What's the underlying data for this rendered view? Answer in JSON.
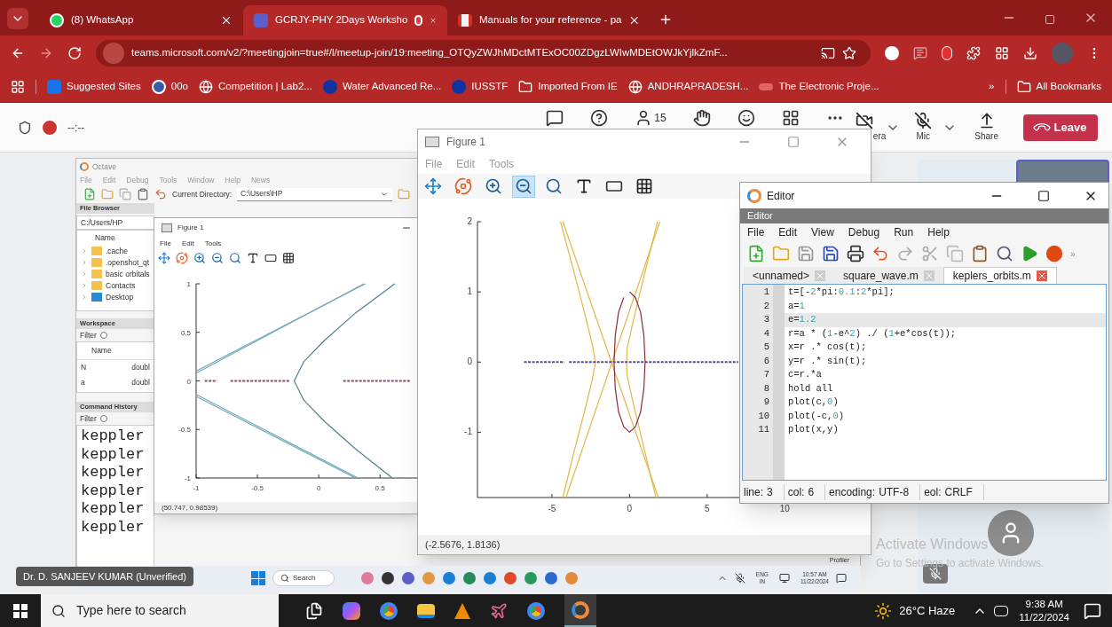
{
  "browser": {
    "tabs": [
      {
        "label": "(8) WhatsApp",
        "kind": "whatsapp",
        "selected": false
      },
      {
        "label": "GCRJY-PHY 2Days Worksho",
        "kind": "teams",
        "selected": true
      },
      {
        "label": "Manuals for your reference - pa",
        "kind": "gmail",
        "selected": false
      }
    ],
    "url": "teams.microsoft.com/v2/?meetingjoin=true#/l/meetup-join/19:meeting_OTQyZWJhMDctMTExOC00ZDgzLWIwMDEtOWJkYjlkZmF...",
    "bookmarks": [
      {
        "label": "Suggested Sites",
        "kind": "bing"
      },
      {
        "label": "00o",
        "kind": "site"
      },
      {
        "label": "Competition | Lab2...",
        "kind": "globe"
      },
      {
        "label": "Water Advanced Re...",
        "kind": "jio"
      },
      {
        "label": "IUSSTF",
        "kind": "jio"
      },
      {
        "label": "Imported From IE",
        "kind": "folder"
      },
      {
        "label": "ANDHRAPRADESH...",
        "kind": "globe"
      },
      {
        "label": "The Electronic Proje...",
        "kind": "link"
      }
    ],
    "more": "»",
    "all_bookmarks": "All Bookmarks"
  },
  "meeting": {
    "timer": "--:--",
    "participants": "15",
    "camera_label": "era",
    "mic_label": "Mic",
    "share_label": "Share",
    "leave_label": "Leave"
  },
  "octave": {
    "title": "Octave",
    "menu": [
      "File",
      "Edit",
      "Debug",
      "Tools",
      "Window",
      "Help",
      "News"
    ],
    "dir_label": "Current Directory:",
    "dir_value": "C:\\Users\\HP",
    "file_browser": {
      "title": "File Browser",
      "path": "C:/Users/HP",
      "column": "Name",
      "items": [
        {
          "name": ".cache",
          "kind": "folder"
        },
        {
          "name": ".openshot_qt",
          "kind": "folder"
        },
        {
          "name": "basic orbitals",
          "kind": "folder"
        },
        {
          "name": "Contacts",
          "kind": "folder"
        },
        {
          "name": "Desktop",
          "kind": "desktop"
        }
      ]
    },
    "workspace": {
      "title": "Workspace",
      "filter": "Filter",
      "filter_checked": false,
      "column": "Name",
      "rows": [
        {
          "name": "N",
          "class": "doubl"
        },
        {
          "name": "a",
          "class": "doubl"
        }
      ]
    },
    "history": {
      "title": "Command History",
      "filter": "Filter",
      "filter_checked": false,
      "items": [
        "keppler",
        "keppler",
        "keppler",
        "keppler",
        "keppler",
        "keppler"
      ]
    },
    "profiler": "Profiler"
  },
  "small_figure": {
    "title": "Figure 1",
    "menu": [
      "File",
      "Edit",
      "Tools"
    ],
    "status": "(50.747, 0.98539)",
    "chart_data": {
      "type": "line",
      "xlim": [
        -1,
        0.81
      ],
      "ylim": [
        -1,
        1
      ],
      "xticks": [
        -1,
        -0.5,
        0,
        0.5
      ],
      "yticks": [
        -1,
        -0.5,
        0,
        0.5,
        1
      ],
      "series": [
        {
          "color": "#6fa8b8",
          "x": [
            -1,
            0.37
          ],
          "values": [
            0.08,
            1
          ]
        },
        {
          "color": "#6fa8b8",
          "x": [
            -1,
            0.38
          ],
          "values": [
            0.1,
            1
          ]
        },
        {
          "color": "#6fa8b8",
          "x": [
            -1,
            0.32
          ],
          "values": [
            -0.14,
            -1
          ]
        },
        {
          "color": "#6fa8b8",
          "x": [
            -1,
            0.3
          ],
          "values": [
            -0.16,
            -1
          ]
        },
        {
          "color": "#4f7f90",
          "x": [
            0.62,
            0.3,
            0.05,
            -0.12,
            -0.2,
            -0.12,
            0.05,
            0.3,
            0.6
          ],
          "values": [
            1,
            0.7,
            0.42,
            0.2,
            0,
            -0.2,
            -0.42,
            -0.7,
            -1
          ]
        },
        {
          "color": "#8a4a6a",
          "line_style": "dotted",
          "x": [
            -0.93,
            -0.83,
            null,
            -0.72,
            -0.24,
            null,
            0.2,
            0.75
          ],
          "values": [
            0,
            0,
            null,
            0,
            0,
            null,
            0,
            0
          ]
        }
      ]
    }
  },
  "figure": {
    "title": "Figure 1",
    "menu": [
      "File",
      "Edit",
      "Tools"
    ],
    "status": "(-2.5676, 1.8136)",
    "toolbar": [
      {
        "kind": "pan",
        "selected": false
      },
      {
        "kind": "rotate",
        "selected": false
      },
      {
        "kind": "zoom-in",
        "selected": false
      },
      {
        "kind": "zoom-out",
        "selected": true
      },
      {
        "kind": "reset",
        "selected": false
      },
      {
        "kind": "text",
        "selected": false
      },
      {
        "kind": "axes",
        "selected": false
      },
      {
        "kind": "grid",
        "selected": false
      }
    ],
    "chart_data": {
      "type": "line",
      "xlim": [
        -9.8,
        14.5
      ],
      "ylim": [
        -1.93,
        2
      ],
      "xticks": [
        -5,
        0,
        5,
        10
      ],
      "yticks": [
        -1,
        0,
        1,
        2
      ],
      "series": [
        {
          "color": "#e3b547",
          "x": [
            -4.45,
            -3.6,
            -2.9,
            -2.4,
            -2.2,
            -2.4,
            -2.9,
            -3.6,
            -4.3
          ],
          "values": [
            2,
            1.3,
            0.7,
            0.25,
            0,
            -0.25,
            -0.7,
            -1.3,
            -1.93
          ]
        },
        {
          "color": "#e3b547",
          "x": [
            -4.3,
            1.85
          ],
          "values": [
            2,
            -1.93
          ]
        },
        {
          "color": "#e3b547",
          "x": [
            -4.1,
            1.95
          ],
          "values": [
            -1.93,
            2
          ]
        },
        {
          "color": "#e3b547",
          "x": [
            1.8,
            0.9,
            0.2,
            -0.15,
            -0.2,
            -0.15,
            0.2,
            0.9,
            1.7
          ],
          "values": [
            2,
            1.2,
            0.55,
            0.2,
            0,
            -0.2,
            -0.55,
            -1.2,
            -1.93
          ]
        },
        {
          "color": "#8b3030",
          "x": [
            0,
            0.38,
            0.71,
            0.92,
            1,
            0.92,
            0.71,
            0.38,
            0,
            -0.38,
            -0.71,
            -0.92,
            -1,
            -0.92,
            -0.71,
            -0.38
          ],
          "values": [
            1,
            0.92,
            0.71,
            0.38,
            0,
            -0.38,
            -0.71,
            -0.92,
            -1,
            -0.92,
            -0.71,
            -0.38,
            0,
            0.38,
            0.71,
            0.92
          ]
        },
        {
          "color": "#5a4a8a",
          "line_style": "dotted",
          "x": [
            -6.8,
            -4.2,
            null,
            -3.9,
            7
          ],
          "values": [
            0,
            0,
            null,
            0,
            0
          ]
        }
      ]
    }
  },
  "editor": {
    "title": "Editor",
    "dock_title": "Editor",
    "menu": [
      "File",
      "Edit",
      "View",
      "Debug",
      "Run",
      "Help"
    ],
    "more": "»",
    "tabs": [
      {
        "label": "<unnamed>",
        "selected": false
      },
      {
        "label": "square_wave.m",
        "selected": false
      },
      {
        "label": "keplers_orbits.m",
        "selected": true
      }
    ],
    "lines": [
      {
        "num": "1",
        "code": "t=[-2*pi:0.1:2*pi];",
        "current": false
      },
      {
        "num": "2",
        "code": "a=1",
        "current": false
      },
      {
        "num": "3",
        "code": "e=1.2",
        "current": true
      },
      {
        "num": "4",
        "code": "r=a * (1-e^2) ./ (1+e*cos(t));",
        "current": false
      },
      {
        "num": "5",
        "code": "x=r .* cos(t);",
        "current": false
      },
      {
        "num": "6",
        "code": "y=r .* sin(t);",
        "current": false
      },
      {
        "num": "7",
        "code": "c=r.*a",
        "current": false
      },
      {
        "num": "8",
        "code": "hold all",
        "current": false
      },
      {
        "num": "9",
        "code": "plot(c,0)",
        "current": false
      },
      {
        "num": "10",
        "code": "plot(-c,0)",
        "current": false
      },
      {
        "num": "11",
        "code": "plot(x,y)",
        "current": false
      }
    ],
    "status": [
      {
        "label": "line:",
        "value": "3"
      },
      {
        "label": "col:",
        "value": "6"
      },
      {
        "label": "encoding:",
        "value": "UTF-8"
      },
      {
        "label": "eol:",
        "value": "CRLF"
      }
    ]
  },
  "activation": {
    "title": "Activate Windows",
    "text": "Go to Settings to activate Windows."
  },
  "presenter": "Dr. D. SANJEEV KUMAR (Unverified)",
  "remote_taskbar": {
    "search": "Search",
    "lang": "ENG",
    "region": "IN",
    "time": "10:57 AM",
    "date": "11/22/2024"
  },
  "taskbar": {
    "search": "Type here to search",
    "weather": "26°C Haze",
    "time": "9:38 AM",
    "date": "11/22/2024"
  }
}
